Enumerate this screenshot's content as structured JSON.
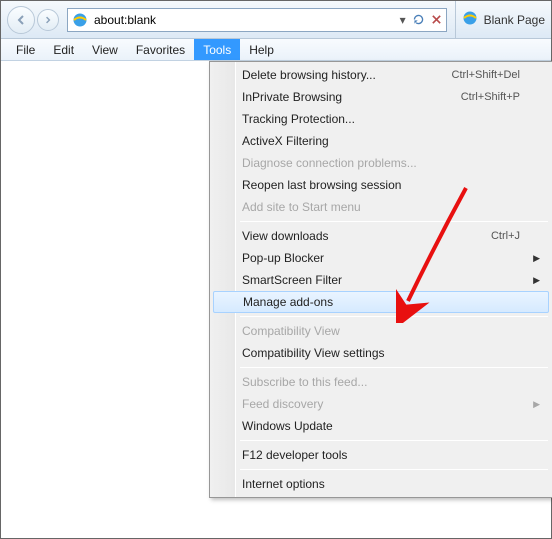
{
  "nav": {
    "address": "about:blank",
    "tab_title": "Blank Page"
  },
  "menubar": {
    "items": [
      "File",
      "Edit",
      "View",
      "Favorites",
      "Tools",
      "Help"
    ],
    "open_index": 4
  },
  "dropdown": {
    "groups": [
      [
        {
          "label": "Delete browsing history...",
          "shortcut": "Ctrl+Shift+Del",
          "disabled": false
        },
        {
          "label": "InPrivate Browsing",
          "shortcut": "Ctrl+Shift+P",
          "disabled": false
        },
        {
          "label": "Tracking Protection...",
          "disabled": false
        },
        {
          "label": "ActiveX Filtering",
          "disabled": false
        },
        {
          "label": "Diagnose connection problems...",
          "disabled": true
        },
        {
          "label": "Reopen last browsing session",
          "disabled": false
        },
        {
          "label": "Add site to Start menu",
          "disabled": true
        }
      ],
      [
        {
          "label": "View downloads",
          "shortcut": "Ctrl+J",
          "disabled": false
        },
        {
          "label": "Pop-up Blocker",
          "submenu": true,
          "disabled": false
        },
        {
          "label": "SmartScreen Filter",
          "submenu": true,
          "disabled": false
        },
        {
          "label": "Manage add-ons",
          "disabled": false,
          "hover": true
        }
      ],
      [
        {
          "label": "Compatibility View",
          "disabled": true
        },
        {
          "label": "Compatibility View settings",
          "disabled": false
        }
      ],
      [
        {
          "label": "Subscribe to this feed...",
          "disabled": true
        },
        {
          "label": "Feed discovery",
          "submenu": true,
          "disabled": true
        },
        {
          "label": "Windows Update",
          "disabled": false
        }
      ],
      [
        {
          "label": "F12 developer tools",
          "disabled": false
        }
      ],
      [
        {
          "label": "Internet options",
          "disabled": false
        }
      ]
    ]
  }
}
